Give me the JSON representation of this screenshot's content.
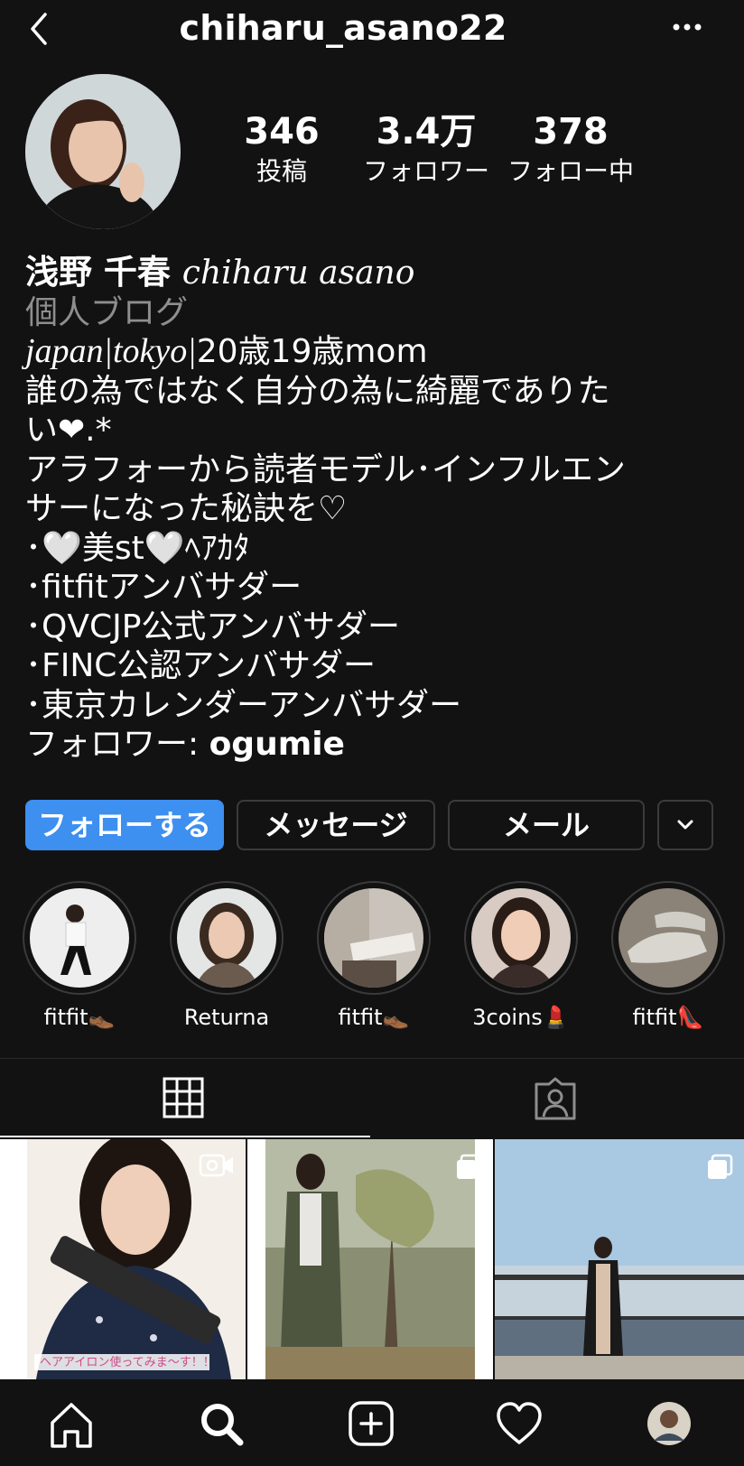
{
  "header": {
    "username": "chiharu_asano22",
    "back_icon": "chevron-left-icon",
    "more_icon": "ellipsis-icon"
  },
  "stats": [
    {
      "value": "346",
      "label": "投稿"
    },
    {
      "value": "3.4万",
      "label": "フォロワー"
    },
    {
      "value": "378",
      "label": "フォロー中"
    }
  ],
  "bio": {
    "name_jp": "浅野 千春",
    "name_en": "chiharu asano",
    "category": "個人ブログ",
    "line1_italic": "japan|tokyo|",
    "line1_rest": "20歳19歳mom",
    "line2": "誰の為ではなく自分の為に綺麗でありた",
    "line3": "い❤︎.*",
    "line4": "アラフォーから読者モデル･インフルエン",
    "line5": "サーになった秘訣を♡",
    "line6": "･🤍美st🤍ﾍｱｶﾀ",
    "line7": "･fitfitアンバサダー",
    "line8": "･QVCJP公式アンバサダー",
    "line9": "･FINC公認アンバサダー",
    "line10": "･東京カレンダーアンバサダー",
    "followed_prefix": "フォロワー: ",
    "followed_user": "ogumie"
  },
  "buttons": {
    "follow": "フォローする",
    "message": "メッセージ",
    "mail": "メール",
    "more_icon": "chevron-down-icon"
  },
  "highlights": [
    {
      "label": "fitfit👞"
    },
    {
      "label": "Returna"
    },
    {
      "label": "fitfit👞"
    },
    {
      "label": "3coins💄"
    },
    {
      "label": "fitfit👠"
    }
  ],
  "tabs": {
    "grid_icon": "grid-icon",
    "tagged_icon": "tagged-person-icon"
  },
  "posts": [
    {
      "type": "video",
      "caption": "ヘアアイロン使ってみま〜す！！"
    },
    {
      "type": "carousel"
    },
    {
      "type": "carousel"
    }
  ],
  "bottom_nav": {
    "home_icon": "home-icon",
    "search_icon": "search-icon",
    "add_icon": "add-post-icon",
    "activity_icon": "heart-icon",
    "profile_icon": "profile-avatar"
  }
}
